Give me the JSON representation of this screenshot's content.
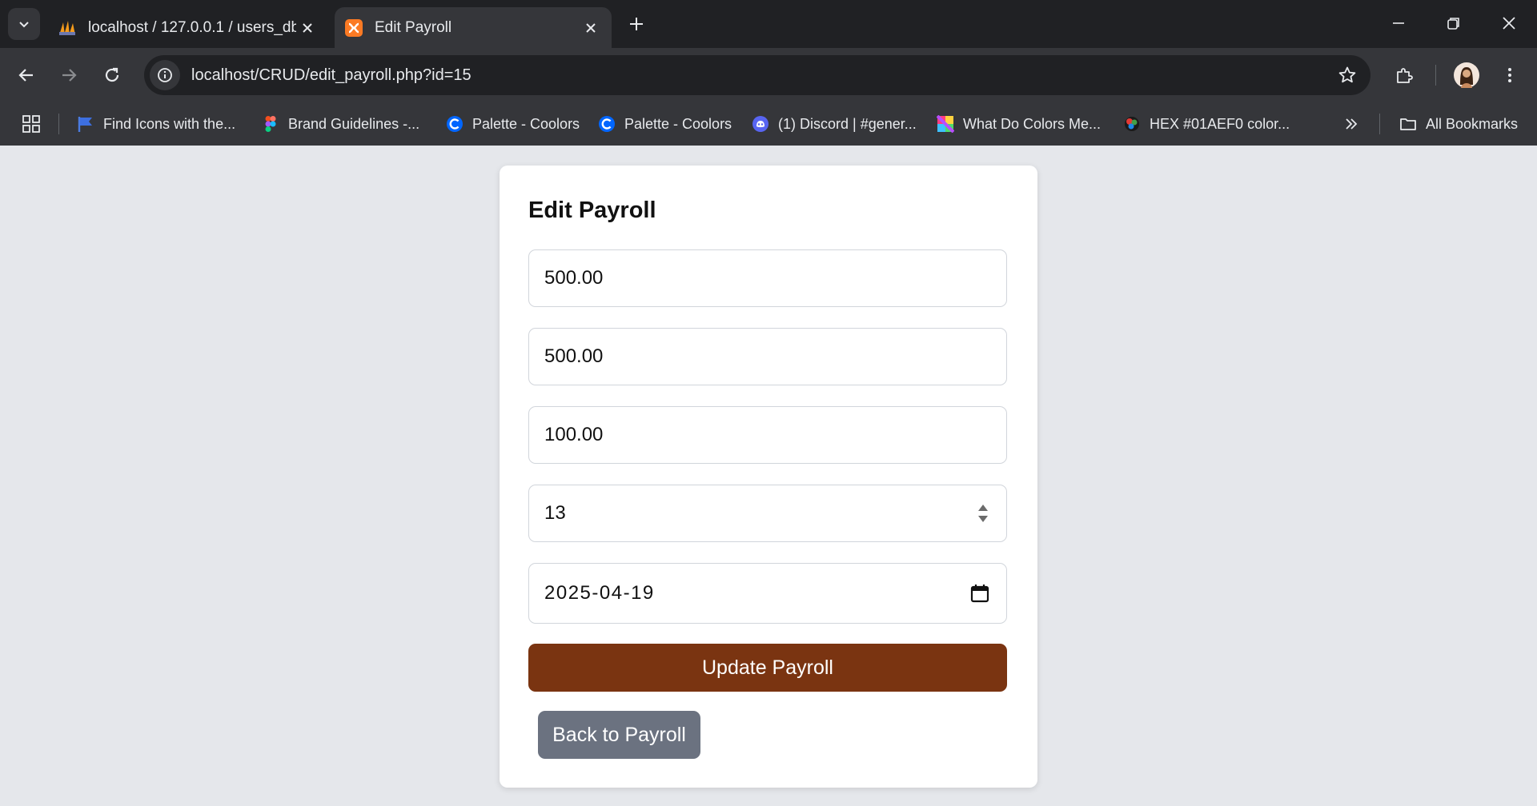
{
  "browser": {
    "tabs": [
      {
        "title": "localhost / 127.0.0.1 / users_db",
        "favicon": "phpmyadmin-icon",
        "active": false
      },
      {
        "title": "Edit Payroll",
        "favicon": "xampp-icon",
        "active": true
      }
    ],
    "address": "localhost/CRUD/edit_payroll.php?id=15",
    "bookmarks": [
      {
        "label": "Find Icons with the...",
        "icon": "flag-icon"
      },
      {
        "label": "Brand Guidelines -...",
        "icon": "figma-icon"
      },
      {
        "label": "Palette - Coolors",
        "icon": "coolors-icon"
      },
      {
        "label": "Palette - Coolors",
        "icon": "coolors-icon"
      },
      {
        "label": "(1) Discord | #gener...",
        "icon": "discord-icon"
      },
      {
        "label": "What Do Colors Me...",
        "icon": "colorwheel-icon"
      },
      {
        "label": "HEX #01AEF0 color...",
        "icon": "colorball-icon"
      }
    ],
    "all_bookmarks_label": "All Bookmarks"
  },
  "form": {
    "title": "Edit Payroll",
    "fields": [
      {
        "value": "500.00",
        "type": "text"
      },
      {
        "value": "500.00",
        "type": "text"
      },
      {
        "value": "100.00",
        "type": "text"
      },
      {
        "value": "13",
        "type": "number"
      },
      {
        "value": "2025-04-19",
        "type": "date"
      }
    ],
    "update_label": "Update Payroll",
    "back_label": "Back to Payroll"
  },
  "colors": {
    "page_background": "#e5e7eb",
    "primary_button": "#7a3411",
    "secondary_button": "#6b7280",
    "chrome_dark": "#202124",
    "chrome_toolbar": "#35363a"
  }
}
